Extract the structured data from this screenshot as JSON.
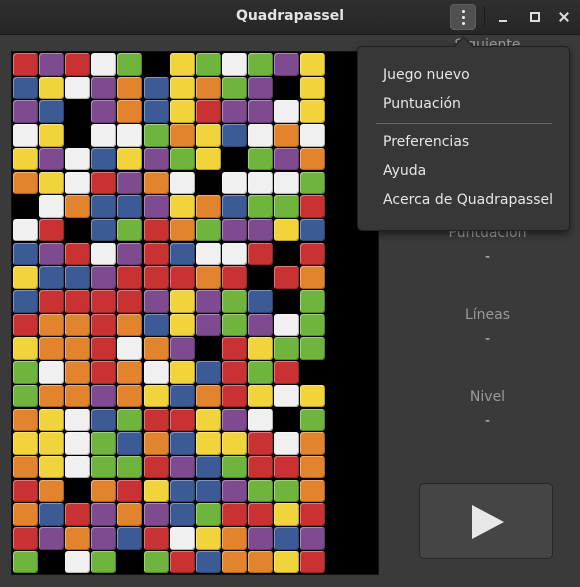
{
  "window": {
    "title": "Quadrapassel"
  },
  "side": {
    "next_label": "Siguiente",
    "score_label": "Puntuación",
    "score_value": "-",
    "lines_label": "Líneas",
    "lines_value": "-",
    "level_label": "Nivel",
    "level_value": "-"
  },
  "menu": {
    "items": [
      {
        "label": "Juego nuevo"
      },
      {
        "label": "Puntuación"
      },
      {
        "label": "Preferencias"
      },
      {
        "label": "Ayuda"
      },
      {
        "label": "Acerca de Quadrapassel"
      }
    ]
  },
  "colors": {
    "W": "#f0f0f0",
    "R": "#c83232",
    "P": "#7e4b91",
    "G": "#6fb43d",
    "Y": "#f1d33b",
    "O": "#e2832e",
    "B": "#3c5a96",
    "K": "#000000"
  },
  "board": {
    "rows": [
      "RPRWGKYGWGPY",
      "BYWPOBYOGPKY",
      "PBKPOBYRPPWY",
      "WYKWWGOYBWOW",
      "YPWBYPGYKGPO",
      "OYWRPOWKWWWG",
      "KWOBBPYOBGGR",
      "WRKBGROGPPYB",
      "BPRWPRBWWRKR",
      "YBBPRRRORKRO",
      "BRRRRPYPGBKG",
      "ROOROBYPGPWG",
      "YOORWOPKRYGG",
      "GWOROWYBRGRK",
      "GOOPOYBORYWY",
      "OYWBGRRYPWKG",
      "YYWGBOBYYRWO",
      "OYWGGRPBGRRO",
      "ROKORYBBPGGO",
      "OBRPOPBGRRYR",
      "RPOPBRWYOPBP",
      "GKWGKGRBOOYR"
    ]
  }
}
